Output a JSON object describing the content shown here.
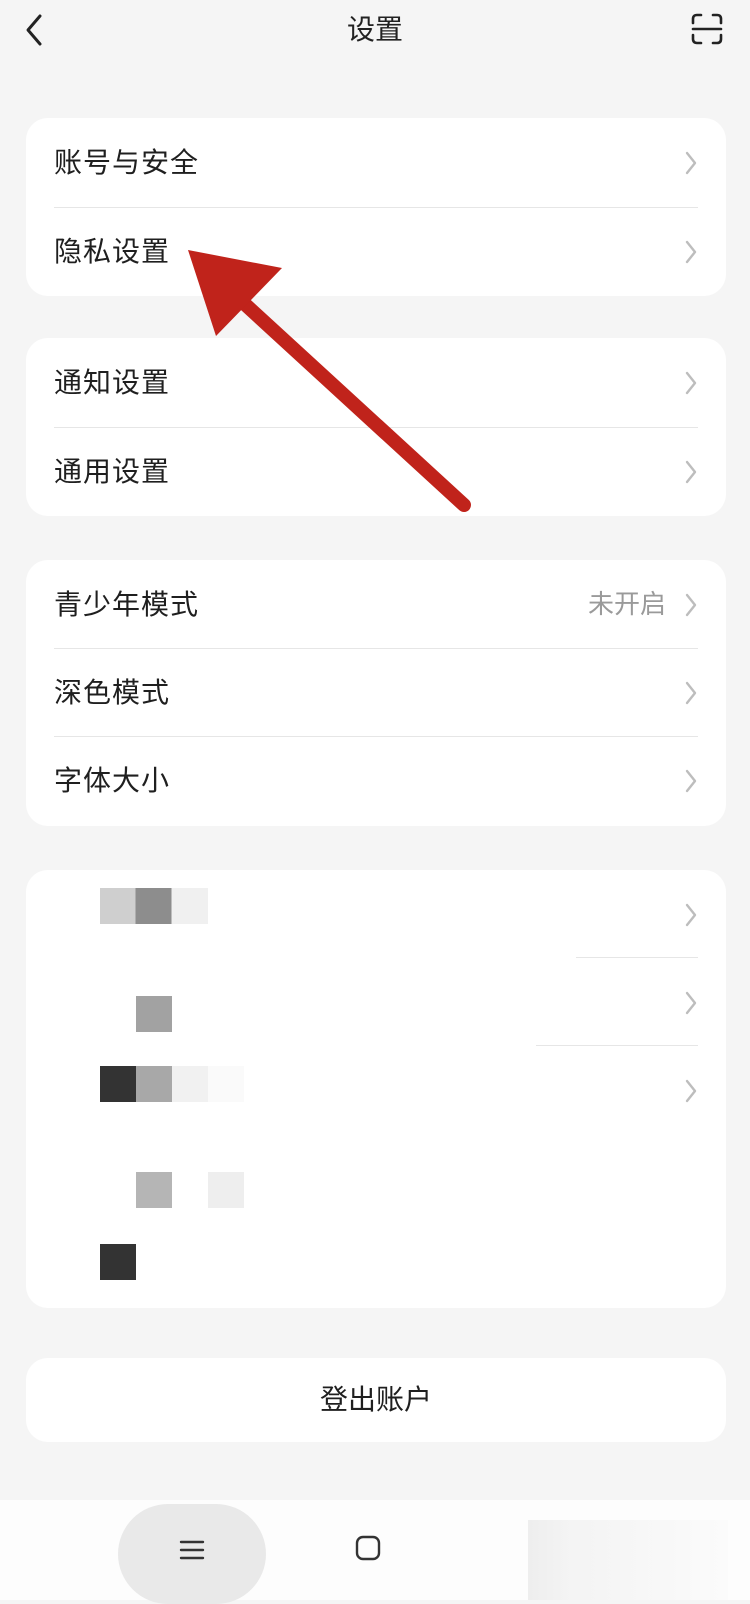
{
  "header": {
    "title": "设置",
    "back_icon": "chevron-left-icon",
    "scan_icon": "scan-icon"
  },
  "groups": [
    {
      "items": [
        {
          "label": "账号与安全"
        },
        {
          "label": "隐私设置"
        }
      ]
    },
    {
      "items": [
        {
          "label": "通知设置"
        },
        {
          "label": "通用设置"
        }
      ]
    },
    {
      "items": [
        {
          "label": "青少年模式",
          "value": "未开启"
        },
        {
          "label": "深色模式"
        },
        {
          "label": "字体大小"
        }
      ]
    }
  ],
  "logout": {
    "label": "登出账户"
  },
  "annotation": {
    "color": "#c0231b",
    "target": "隐私设置"
  },
  "navbar": {
    "menu_icon": "menu-icon",
    "home_icon": "home-icon"
  }
}
